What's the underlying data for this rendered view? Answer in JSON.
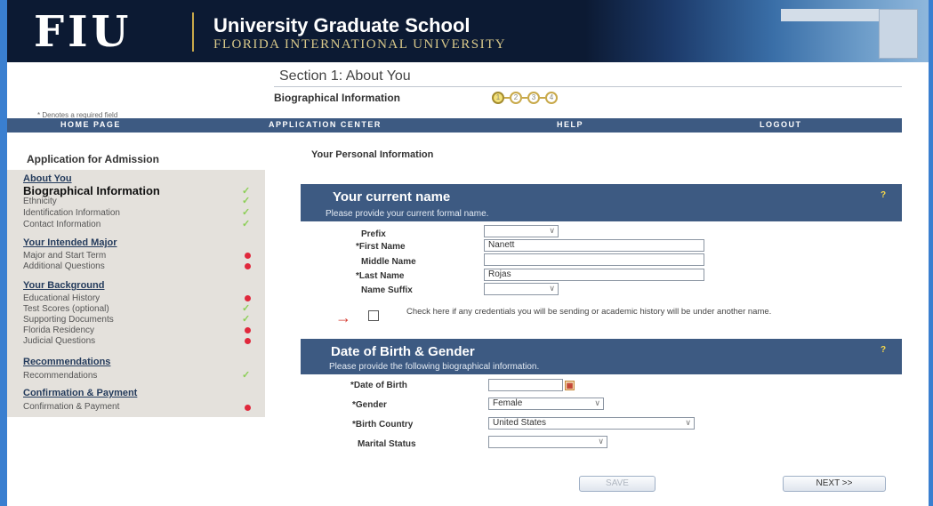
{
  "header": {
    "logo": "FIU",
    "school": "University Graduate School",
    "university": "FLORIDA INTERNATIONAL UNIVERSITY"
  },
  "section": {
    "title": "Section 1: About You",
    "subtitle": "Biographical Information",
    "steps": [
      "1",
      "2",
      "3",
      "4"
    ],
    "required_note": "* Denotes a required field"
  },
  "nav": {
    "home": "HOME PAGE",
    "app_center": "APPLICATION CENTER",
    "help": "HELP",
    "logout": "LOGOUT"
  },
  "sidebar": {
    "title": "Application for Admission",
    "groups": [
      {
        "heading": "About You",
        "items": [
          {
            "label": "Biographical Information",
            "status": "complete",
            "current": true
          },
          {
            "label": "Ethnicity",
            "status": "complete"
          },
          {
            "label": "Identification Information",
            "status": "complete"
          },
          {
            "label": "Contact Information",
            "status": "complete"
          }
        ]
      },
      {
        "heading": "Your Intended Major",
        "items": [
          {
            "label": "Major and Start Term",
            "status": "incomplete"
          },
          {
            "label": "Additional Questions",
            "status": "incomplete"
          }
        ]
      },
      {
        "heading": "Your Background",
        "items": [
          {
            "label": "Educational History",
            "status": "incomplete"
          },
          {
            "label": "Test Scores (optional)",
            "status": "complete"
          },
          {
            "label": "Supporting Documents",
            "status": "complete"
          },
          {
            "label": "Florida Residency",
            "status": "incomplete"
          },
          {
            "label": "Judicial Questions",
            "status": "incomplete"
          }
        ]
      },
      {
        "heading": "Recommendations",
        "items": [
          {
            "label": "Recommendations",
            "status": "complete"
          }
        ]
      },
      {
        "heading": "Confirmation & Payment",
        "items": [
          {
            "label": "Confirmation & Payment",
            "status": "incomplete"
          }
        ]
      }
    ]
  },
  "main": {
    "section_heading": "Your Personal Information",
    "name_panel": {
      "title": "Your current name",
      "subtitle": "Please provide your current formal name.",
      "prefix_label": "Prefix",
      "prefix_value": "",
      "first_label": "*First Name",
      "first_value": "Nanett",
      "middle_label": "Middle Name",
      "middle_value": "",
      "last_label": "*Last Name",
      "last_value": "Rojas",
      "suffix_label": "Name Suffix",
      "suffix_value": "",
      "credentials_text": "Check here if any credentials you will be sending or academic history will be under another name."
    },
    "birth_panel": {
      "title": "Date of Birth & Gender",
      "subtitle": "Please provide the following biographical information.",
      "dob_label": "*Date of Birth",
      "dob_value": "",
      "gender_label": "*Gender",
      "gender_value": "Female",
      "country_label": "*Birth Country",
      "country_value": "United States",
      "marital_label": "Marital Status",
      "marital_value": ""
    },
    "buttons": {
      "save": "SAVE",
      "next": "NEXT >>"
    }
  },
  "colors": {
    "nav_bg": "#3d5a82",
    "header_bg": "#0c1a33",
    "check": "#8ccf56",
    "incomplete": "#e0283c"
  }
}
